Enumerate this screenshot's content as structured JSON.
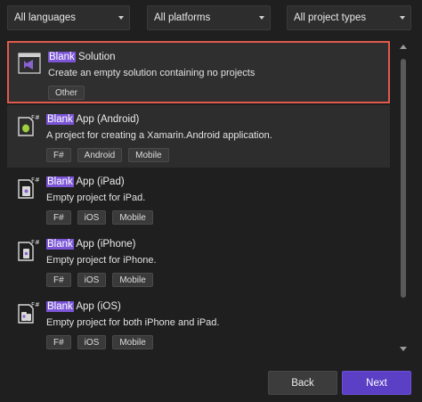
{
  "filters": {
    "languages": "All languages",
    "platforms": "All platforms",
    "project_types": "All project types"
  },
  "templates": [
    {
      "icon": "visual-studio-solution-icon",
      "title_match": "Blank",
      "title_rest": " Solution",
      "description": "Create an empty solution containing no projects",
      "tags": [
        "Other"
      ],
      "selected": true
    },
    {
      "icon": "fsharp-android-project-icon",
      "title_match": "Blank",
      "title_rest": " App (Android)",
      "description": "A project for creating a Xamarin.Android application.",
      "tags": [
        "F#",
        "Android",
        "Mobile"
      ]
    },
    {
      "icon": "fsharp-ipad-project-icon",
      "title_match": "Blank",
      "title_rest": " App (iPad)",
      "description": "Empty project for iPad.",
      "tags": [
        "F#",
        "iOS",
        "Mobile"
      ]
    },
    {
      "icon": "fsharp-iphone-project-icon",
      "title_match": "Blank",
      "title_rest": " App (iPhone)",
      "description": "Empty project for iPhone.",
      "tags": [
        "F#",
        "iOS",
        "Mobile"
      ]
    },
    {
      "icon": "fsharp-ios-project-icon",
      "title_match": "Blank",
      "title_rest": " App (iOS)",
      "description": "Empty project for both iPhone and iPad.",
      "tags": [
        "F#",
        "iOS",
        "Mobile"
      ]
    }
  ],
  "buttons": {
    "back": "Back",
    "next": "Next"
  },
  "colors": {
    "background": "#1f1f1f",
    "highlight": "#7b55d6",
    "selection_border": "#e05a4a",
    "primary_button": "#5b3fc4"
  }
}
